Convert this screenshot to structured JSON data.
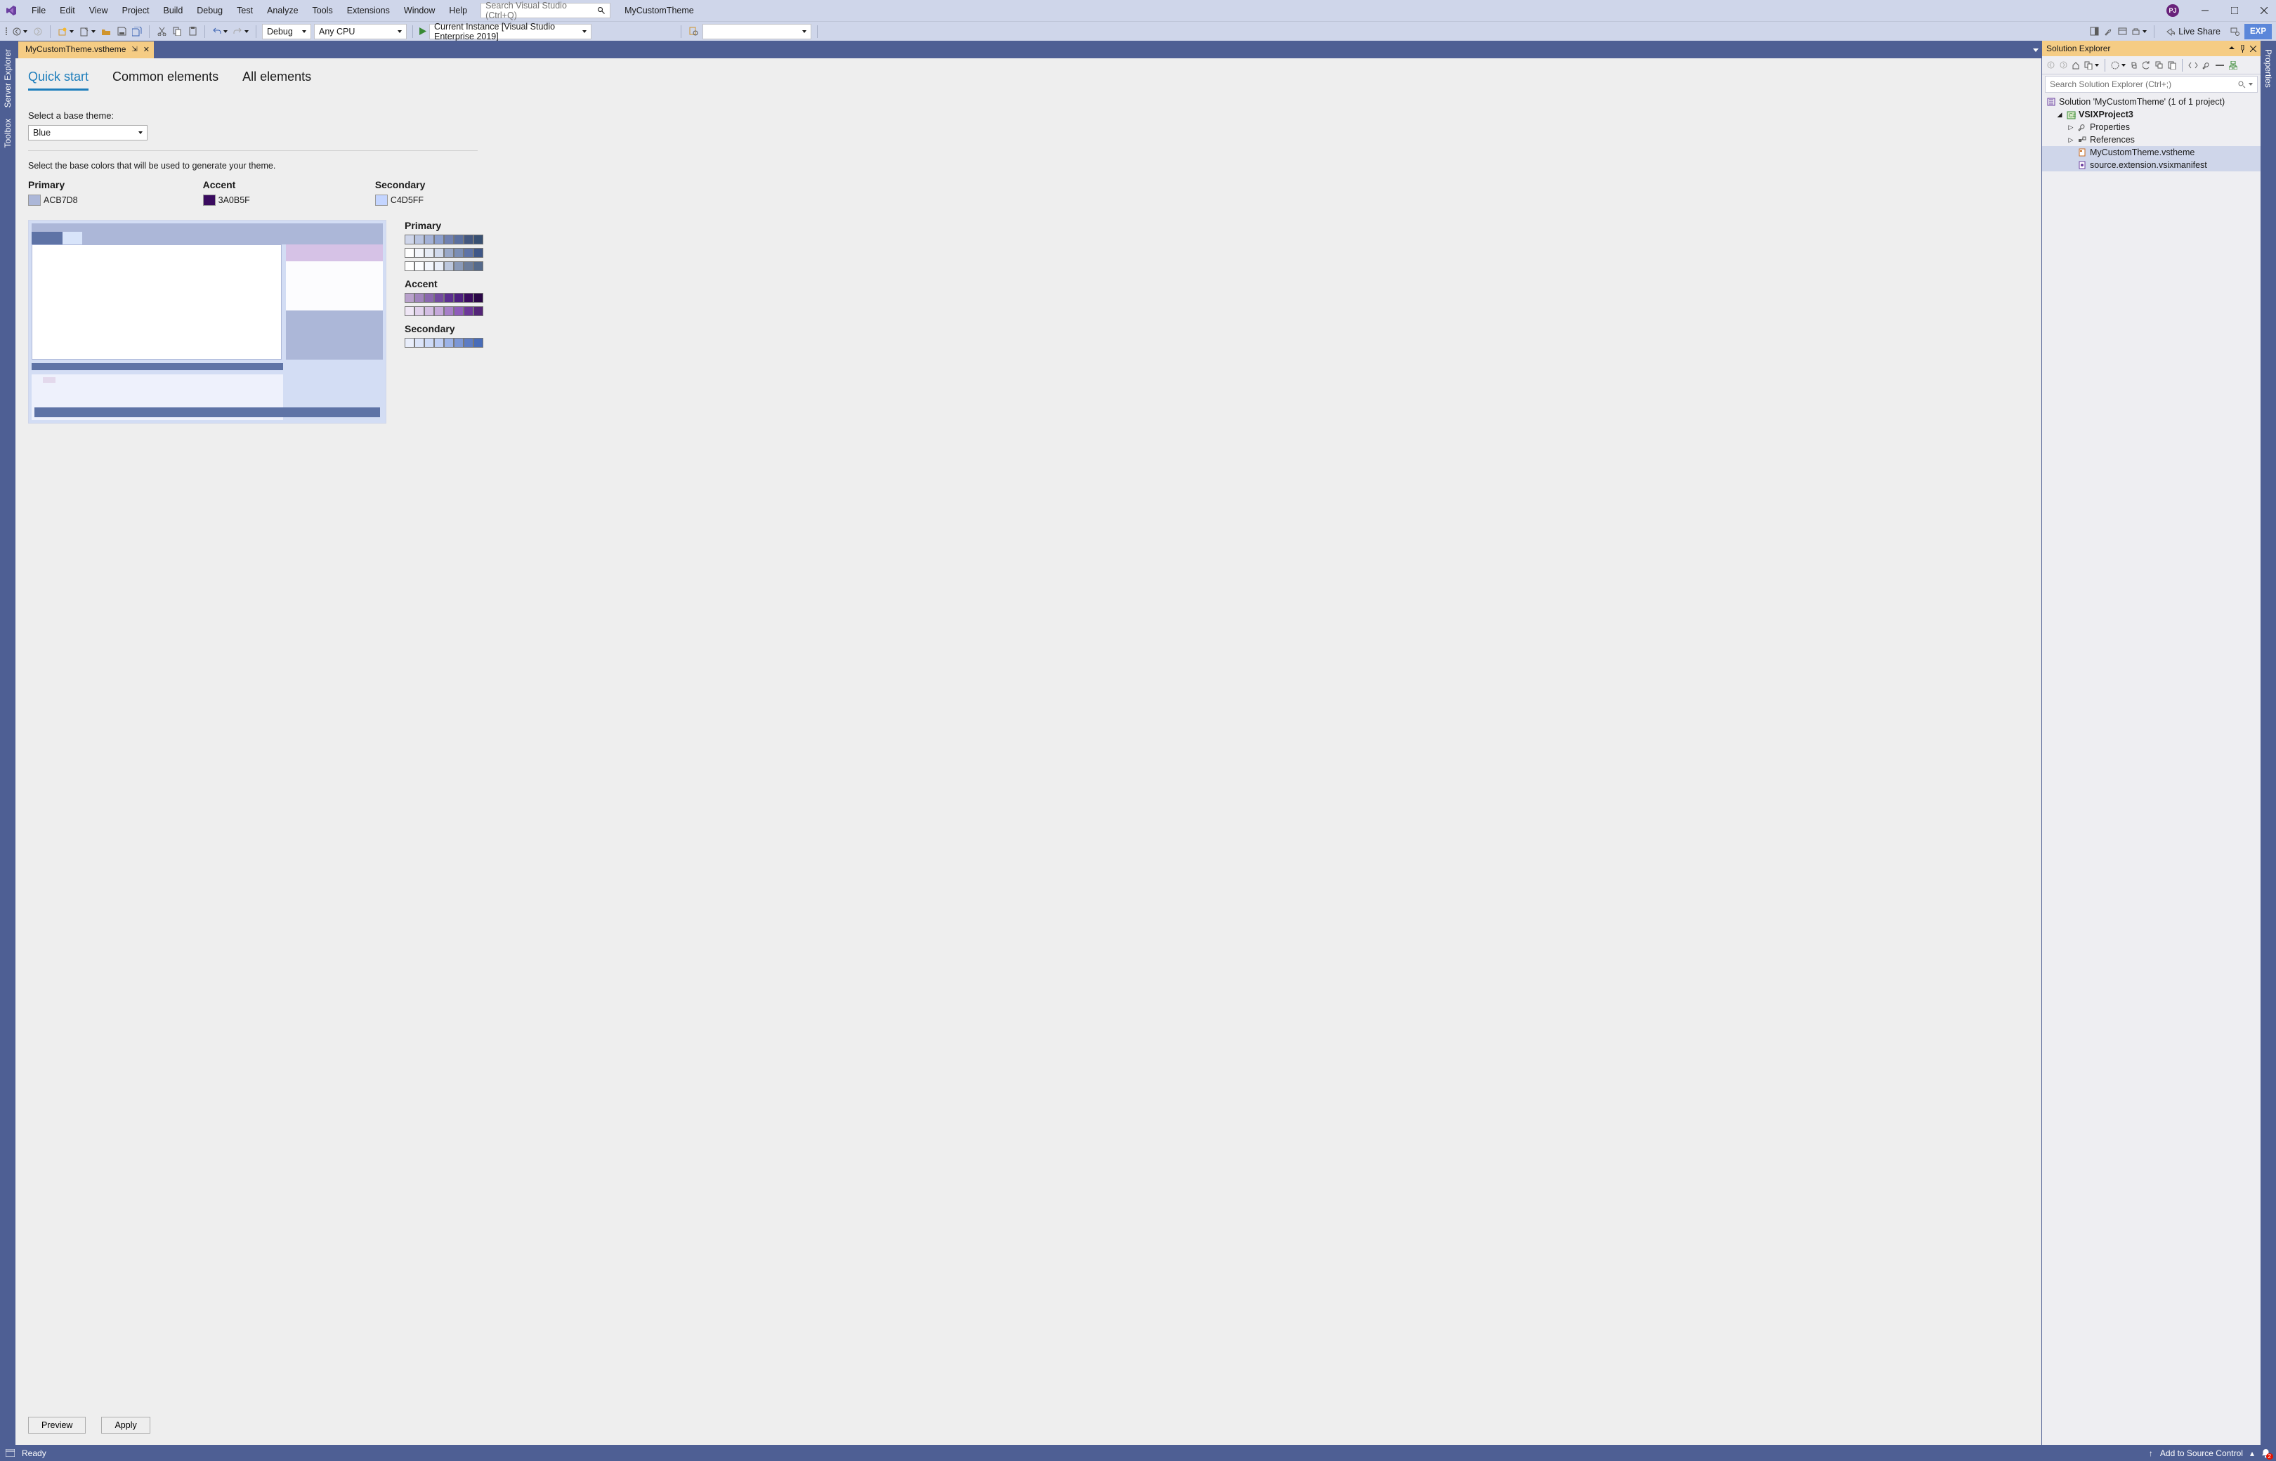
{
  "titlebar": {
    "menu": [
      "File",
      "Edit",
      "View",
      "Project",
      "Build",
      "Debug",
      "Test",
      "Analyze",
      "Tools",
      "Extensions",
      "Window",
      "Help"
    ],
    "search_placeholder": "Search Visual Studio (Ctrl+Q)",
    "project_name": "MyCustomTheme",
    "user_initials": "PJ"
  },
  "toolbar": {
    "config": "Debug",
    "platform": "Any CPU",
    "run_target": "Current Instance  [Visual Studio Enterprise 2019]",
    "live_share": "Live Share",
    "exp": "EXP"
  },
  "doc_tab": {
    "name": "MyCustomTheme.vstheme"
  },
  "left_gutter": {
    "tabs": [
      "Server Explorer",
      "Toolbox"
    ]
  },
  "right_gutter": {
    "tabs": [
      "Properties"
    ]
  },
  "theme_editor": {
    "tabs": {
      "quick": "Quick start",
      "common": "Common elements",
      "all": "All elements",
      "active": 0
    },
    "select_base_label": "Select a base theme:",
    "base_theme": "Blue",
    "instruction": "Select the base colors that will be used to generate your theme.",
    "colors": {
      "primary": {
        "label": "Primary",
        "value": "ACB7D8",
        "swatch": "#acb7d8"
      },
      "accent": {
        "label": "Accent",
        "value": "3A0B5F",
        "swatch": "#3a0b5f"
      },
      "secondary": {
        "label": "Secondary",
        "value": "C4D5FF",
        "swatch": "#c4d5ff"
      }
    },
    "palette": {
      "primary_label": "Primary",
      "accent_label": "Accent",
      "secondary_label": "Secondary",
      "primary_rows": [
        [
          "#cfd6ea",
          "#b9c4e0",
          "#a3b1d6",
          "#8c9fcd",
          "#7081b1",
          "#5a6f9f",
          "#43577f",
          "#385072"
        ],
        [
          "#ffffff",
          "#f4f6fb",
          "#e6ebf5",
          "#d0d9ec",
          "#99a8c8",
          "#7b8eb5",
          "#5e73a6",
          "#3f5788"
        ],
        [
          "#ffffff",
          "#fcfdff",
          "#f3f6fc",
          "#e9eef8",
          "#bcc7dd",
          "#8a9ab8",
          "#6b7c9a",
          "#556a8b"
        ]
      ],
      "accent_rows": [
        [
          "#b9a1cc",
          "#a184bd",
          "#8a67ae",
          "#734a9f",
          "#5c2e90",
          "#4e1f80",
          "#3a0b5f",
          "#2a0747"
        ],
        [
          "#efe6f5",
          "#e1d1ec",
          "#d3bde3",
          "#c5a8da",
          "#a77fc8",
          "#8f5cba",
          "#6d3799",
          "#542577"
        ]
      ],
      "secondary_row": [
        "#e9eefb",
        "#dbe4f9",
        "#cddaf7",
        "#bfcff5",
        "#9cb3e7",
        "#7c97d5",
        "#5d7cc3",
        "#486cb8"
      ]
    },
    "buttons": {
      "preview": "Preview",
      "apply": "Apply"
    }
  },
  "solution_explorer": {
    "title": "Solution Explorer",
    "search_placeholder": "Search Solution Explorer (Ctrl+;)",
    "solution": "Solution 'MyCustomTheme' (1 of 1 project)",
    "project": "VSIXProject3",
    "nodes": {
      "properties": "Properties",
      "references": "References",
      "theme_file": "MyCustomTheme.vstheme",
      "manifest": "source.extension.vsixmanifest"
    }
  },
  "statusbar": {
    "ready": "Ready",
    "add_source": "Add to Source Control",
    "notif_count": "2"
  }
}
